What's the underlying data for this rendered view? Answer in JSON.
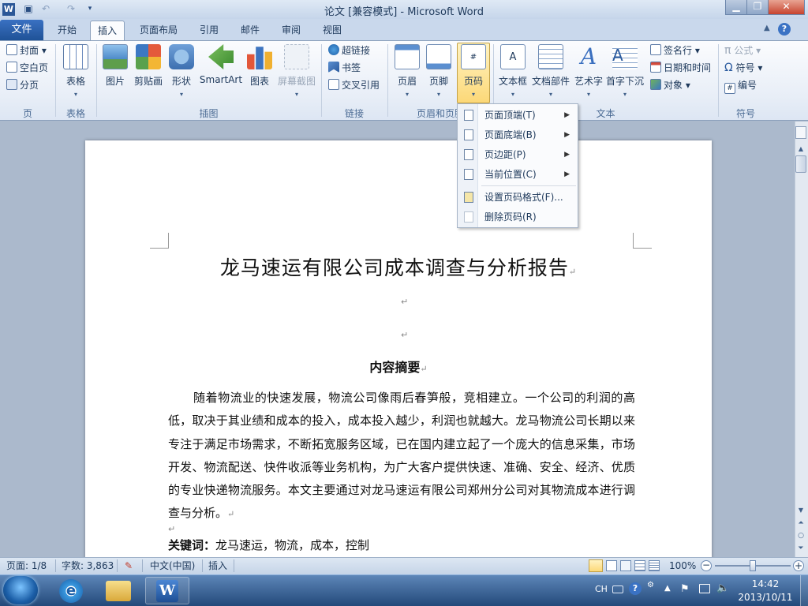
{
  "window": {
    "title": "论文 [兼容模式] - Microsoft Word",
    "app_icon": "W",
    "min_label": "▁",
    "max_label": "❐",
    "close_label": "✕"
  },
  "tabs": {
    "file": "文件",
    "items": [
      "开始",
      "插入",
      "页面布局",
      "引用",
      "邮件",
      "审阅",
      "视图"
    ],
    "active": "插入"
  },
  "ribbon": {
    "pages": {
      "label": "页",
      "items": [
        "封面",
        "空白页",
        "分页"
      ]
    },
    "tables": {
      "label": "表格",
      "button": "表格"
    },
    "illustrations": {
      "label": "插图",
      "buttons": [
        "图片",
        "剪贴画",
        "形状",
        "SmartArt",
        "图表",
        "屏幕截图"
      ]
    },
    "links": {
      "label": "链接",
      "items": [
        "超链接",
        "书签",
        "交叉引用"
      ]
    },
    "header_footer": {
      "label": "页眉和页脚",
      "buttons": [
        "页眉",
        "页脚",
        "页码"
      ]
    },
    "text": {
      "label": "文本",
      "buttons": [
        "文本框",
        "文档部件",
        "艺术字",
        "首字下沉"
      ],
      "items": [
        "签名行",
        "日期和时间",
        "对象"
      ]
    },
    "symbols": {
      "label": "符号",
      "items": [
        "公式",
        "符号",
        "编号"
      ]
    }
  },
  "page_number_menu": {
    "items": [
      {
        "label": "页面顶端(T)",
        "submenu": true,
        "enabled": true
      },
      {
        "label": "页面底端(B)",
        "submenu": true,
        "enabled": true
      },
      {
        "label": "页边距(P)",
        "submenu": true,
        "enabled": true
      },
      {
        "label": "当前位置(C)",
        "submenu": true,
        "enabled": true
      },
      {
        "label": "设置页码格式(F)...",
        "submenu": false,
        "enabled": true
      },
      {
        "label": "删除页码(R)",
        "submenu": false,
        "enabled": false
      }
    ]
  },
  "document": {
    "title": "龙马速运有限公司成本调查与分析报告",
    "abstract_heading": "内容摘要",
    "abstract_text": "随着物流业的快速发展，物流公司像雨后春笋般，竞相建立。一个公司的利润的高低，取决于其业绩和成本的投入，成本投入越少，利润也就越大。龙马物流公司长期以来专注于满足市场需求，不断拓宽服务区域，已在国内建立起了一个庞大的信息采集，市场开发、物流配送、快件收派等业务机构，为广大客户提供快速、准确、安全、经济、优质的专业快递物流服务。本文主要通过对龙马速运有限公司郑州分公司对其物流成本进行调查与分析。",
    "keywords_label": "关键词：",
    "keywords": "龙马速运，物流，成本，控制",
    "para_mark": "↵"
  },
  "status": {
    "page": "页面: 1/8",
    "words": "字数: 3,863",
    "language": "中文(中国)",
    "mode": "插入",
    "zoom": "100%"
  },
  "taskbar": {
    "ime": "CH",
    "time": "14:42",
    "date": "2013/10/11"
  },
  "colors": {
    "accent": "#1f5297",
    "menu_highlight": "#fcd878"
  }
}
